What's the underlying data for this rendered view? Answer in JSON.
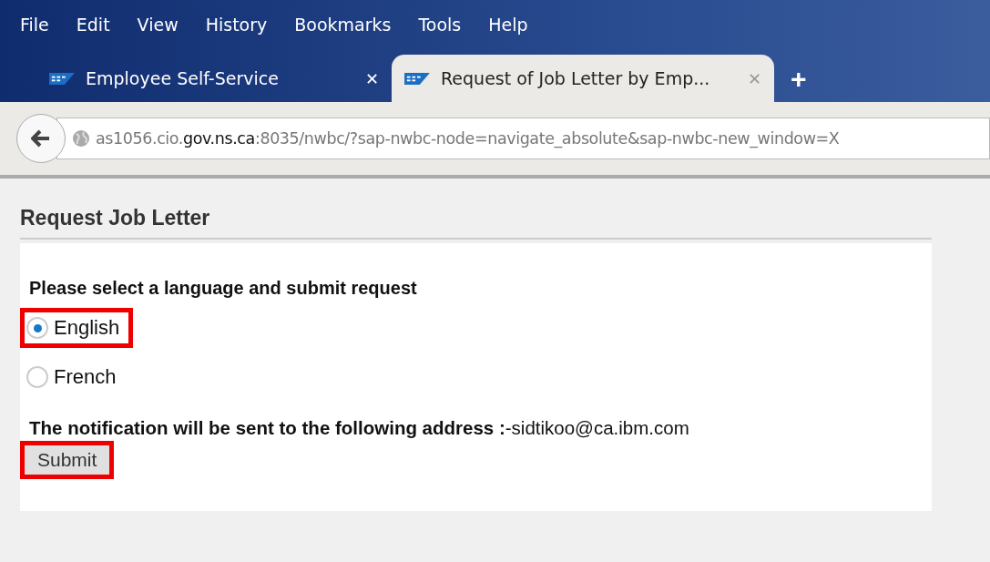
{
  "menu": [
    "File",
    "Edit",
    "View",
    "History",
    "Bookmarks",
    "Tools",
    "Help"
  ],
  "tabs": [
    {
      "label": "Employee Self-Service",
      "selected": false,
      "close": "✕"
    },
    {
      "label": "Request of Job Letter by Emp...",
      "selected": true,
      "close": "✕"
    }
  ],
  "new_tab": "+",
  "address": "as1056.cio.**gov.ns.ca**:8035/nwbc/?sap-nwbc-node=navigate_absolute&sap-nwbc-new_window=X",
  "page": {
    "title": "Request Job Letter",
    "prompt": "Please select a language and submit request",
    "options": [
      {
        "label": "English",
        "selected": true,
        "highlighted": true
      },
      {
        "label": "French",
        "selected": false,
        "highlighted": false
      }
    ],
    "notice": "**The notification will be sent to the following address :**-sidtikoo@ca.ibm.com",
    "submit": {
      "label": "Submit",
      "highlighted": true
    }
  }
}
